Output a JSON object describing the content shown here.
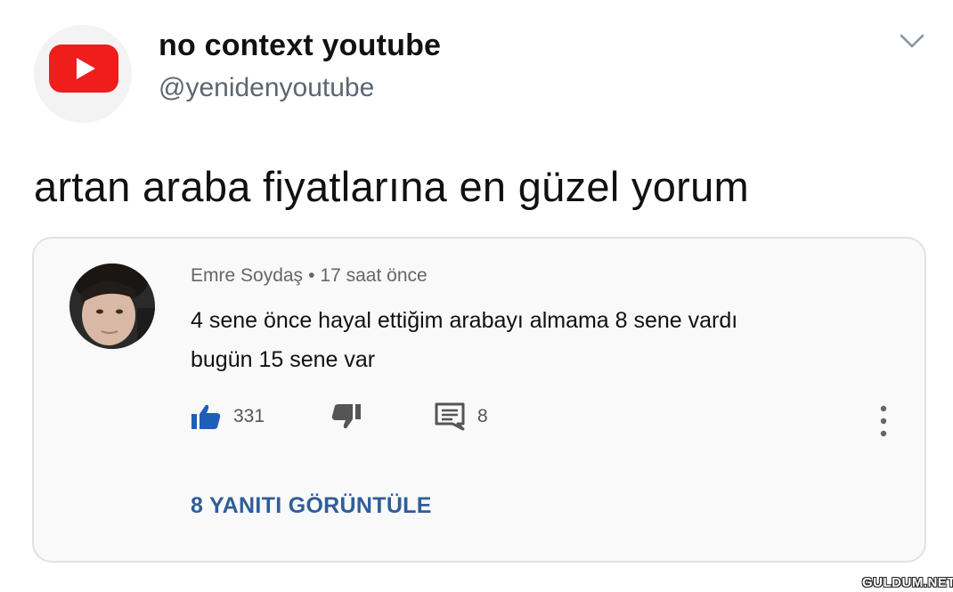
{
  "tweet": {
    "author_name": "no context youtube",
    "author_handle": "@yenidenyoutube",
    "text": "artan araba fiyatlarına en güzel yorum",
    "avatar_icon": "youtube-logo-icon",
    "menu_icon": "chevron-down-icon"
  },
  "comment": {
    "author": "Emre Soydaş",
    "separator": "•",
    "time": "17 saat önce",
    "text_line1": "4 sene önce hayal ettiğim arabayı almama 8 sene vardı",
    "text_line2": "bugün 15 sene var",
    "like_count": "331",
    "reply_count": "8",
    "view_replies": "8 YANITI GÖRÜNTÜLE",
    "like_icon": "thumbs-up-icon",
    "dislike_icon": "thumbs-down-icon",
    "reply_icon": "comment-icon",
    "more_icon": "more-vertical-icon"
  },
  "watermark": "GULDUM.NET",
  "colors": {
    "youtube_red": "#ff0000",
    "like_blue": "#1e5fb8",
    "link_blue": "#2f5d9a"
  }
}
